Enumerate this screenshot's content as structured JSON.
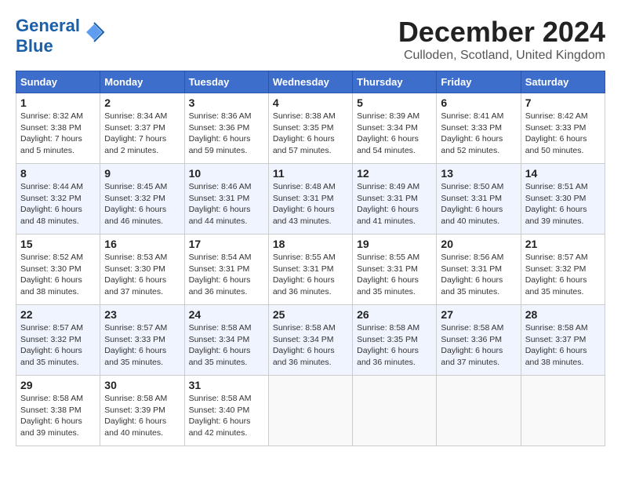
{
  "header": {
    "logo_line1": "General",
    "logo_line2": "Blue",
    "month": "December 2024",
    "location": "Culloden, Scotland, United Kingdom"
  },
  "weekdays": [
    "Sunday",
    "Monday",
    "Tuesday",
    "Wednesday",
    "Thursday",
    "Friday",
    "Saturday"
  ],
  "weeks": [
    [
      {
        "day": "1",
        "sunrise": "8:32 AM",
        "sunset": "3:38 PM",
        "daylight": "7 hours and 5 minutes."
      },
      {
        "day": "2",
        "sunrise": "8:34 AM",
        "sunset": "3:37 PM",
        "daylight": "7 hours and 2 minutes."
      },
      {
        "day": "3",
        "sunrise": "8:36 AM",
        "sunset": "3:36 PM",
        "daylight": "6 hours and 59 minutes."
      },
      {
        "day": "4",
        "sunrise": "8:38 AM",
        "sunset": "3:35 PM",
        "daylight": "6 hours and 57 minutes."
      },
      {
        "day": "5",
        "sunrise": "8:39 AM",
        "sunset": "3:34 PM",
        "daylight": "6 hours and 54 minutes."
      },
      {
        "day": "6",
        "sunrise": "8:41 AM",
        "sunset": "3:33 PM",
        "daylight": "6 hours and 52 minutes."
      },
      {
        "day": "7",
        "sunrise": "8:42 AM",
        "sunset": "3:33 PM",
        "daylight": "6 hours and 50 minutes."
      }
    ],
    [
      {
        "day": "8",
        "sunrise": "8:44 AM",
        "sunset": "3:32 PM",
        "daylight": "6 hours and 48 minutes."
      },
      {
        "day": "9",
        "sunrise": "8:45 AM",
        "sunset": "3:32 PM",
        "daylight": "6 hours and 46 minutes."
      },
      {
        "day": "10",
        "sunrise": "8:46 AM",
        "sunset": "3:31 PM",
        "daylight": "6 hours and 44 minutes."
      },
      {
        "day": "11",
        "sunrise": "8:48 AM",
        "sunset": "3:31 PM",
        "daylight": "6 hours and 43 minutes."
      },
      {
        "day": "12",
        "sunrise": "8:49 AM",
        "sunset": "3:31 PM",
        "daylight": "6 hours and 41 minutes."
      },
      {
        "day": "13",
        "sunrise": "8:50 AM",
        "sunset": "3:31 PM",
        "daylight": "6 hours and 40 minutes."
      },
      {
        "day": "14",
        "sunrise": "8:51 AM",
        "sunset": "3:30 PM",
        "daylight": "6 hours and 39 minutes."
      }
    ],
    [
      {
        "day": "15",
        "sunrise": "8:52 AM",
        "sunset": "3:30 PM",
        "daylight": "6 hours and 38 minutes."
      },
      {
        "day": "16",
        "sunrise": "8:53 AM",
        "sunset": "3:30 PM",
        "daylight": "6 hours and 37 minutes."
      },
      {
        "day": "17",
        "sunrise": "8:54 AM",
        "sunset": "3:31 PM",
        "daylight": "6 hours and 36 minutes."
      },
      {
        "day": "18",
        "sunrise": "8:55 AM",
        "sunset": "3:31 PM",
        "daylight": "6 hours and 36 minutes."
      },
      {
        "day": "19",
        "sunrise": "8:55 AM",
        "sunset": "3:31 PM",
        "daylight": "6 hours and 35 minutes."
      },
      {
        "day": "20",
        "sunrise": "8:56 AM",
        "sunset": "3:31 PM",
        "daylight": "6 hours and 35 minutes."
      },
      {
        "day": "21",
        "sunrise": "8:57 AM",
        "sunset": "3:32 PM",
        "daylight": "6 hours and 35 minutes."
      }
    ],
    [
      {
        "day": "22",
        "sunrise": "8:57 AM",
        "sunset": "3:32 PM",
        "daylight": "6 hours and 35 minutes."
      },
      {
        "day": "23",
        "sunrise": "8:57 AM",
        "sunset": "3:33 PM",
        "daylight": "6 hours and 35 minutes."
      },
      {
        "day": "24",
        "sunrise": "8:58 AM",
        "sunset": "3:34 PM",
        "daylight": "6 hours and 35 minutes."
      },
      {
        "day": "25",
        "sunrise": "8:58 AM",
        "sunset": "3:34 PM",
        "daylight": "6 hours and 36 minutes."
      },
      {
        "day": "26",
        "sunrise": "8:58 AM",
        "sunset": "3:35 PM",
        "daylight": "6 hours and 36 minutes."
      },
      {
        "day": "27",
        "sunrise": "8:58 AM",
        "sunset": "3:36 PM",
        "daylight": "6 hours and 37 minutes."
      },
      {
        "day": "28",
        "sunrise": "8:58 AM",
        "sunset": "3:37 PM",
        "daylight": "6 hours and 38 minutes."
      }
    ],
    [
      {
        "day": "29",
        "sunrise": "8:58 AM",
        "sunset": "3:38 PM",
        "daylight": "6 hours and 39 minutes."
      },
      {
        "day": "30",
        "sunrise": "8:58 AM",
        "sunset": "3:39 PM",
        "daylight": "6 hours and 40 minutes."
      },
      {
        "day": "31",
        "sunrise": "8:58 AM",
        "sunset": "3:40 PM",
        "daylight": "6 hours and 42 minutes."
      },
      null,
      null,
      null,
      null
    ]
  ],
  "labels": {
    "sunrise_prefix": "Sunrise: ",
    "sunset_prefix": "Sunset: ",
    "daylight_prefix": "Daylight: "
  }
}
